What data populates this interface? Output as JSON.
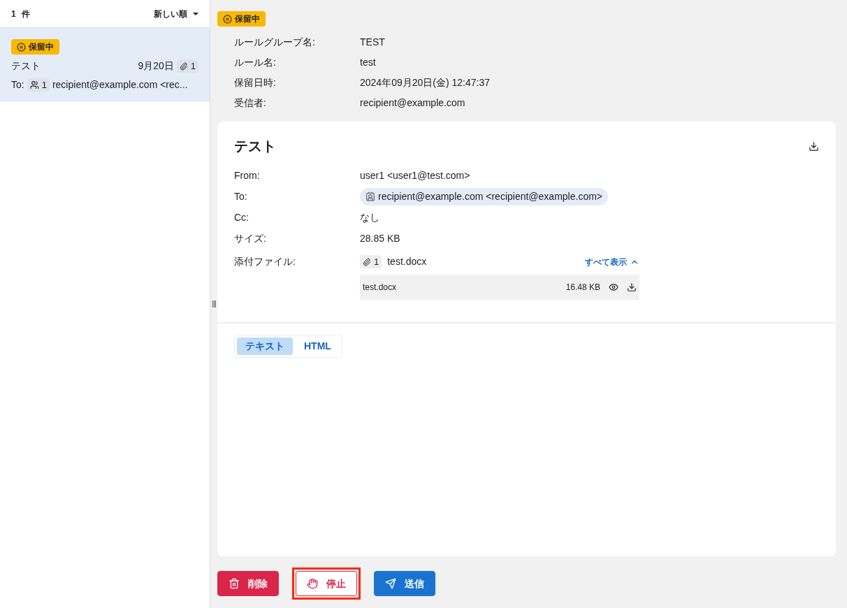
{
  "list_header": {
    "count": "1",
    "count_unit": "件",
    "sort": "新しい順"
  },
  "messages": [
    {
      "status": "保留中",
      "subject": "テスト",
      "date": "9月20日",
      "attachments": "1",
      "to_label": "To:",
      "recipients": "1",
      "to": "recipient@example.com <rec...",
      "selected": true
    }
  ],
  "hold_info": {
    "status": "保留中",
    "fields": [
      {
        "label": "ルールグループ名:",
        "value": "TEST"
      },
      {
        "label": "ルール名:",
        "value": "test"
      },
      {
        "label": "保留日時:",
        "value": "2024年09月20日(金) 12:47:37"
      },
      {
        "label": "受信者:",
        "value": "recipient@example.com"
      }
    ]
  },
  "mail": {
    "subject": "テスト",
    "fields": [
      {
        "kind": "text",
        "label": "From:",
        "value": "user1 <user1@test.com>"
      },
      {
        "kind": "chip",
        "label": "To:",
        "value": "recipient@example.com <recipient@example.com>"
      },
      {
        "kind": "text",
        "label": "Cc:",
        "value": "なし"
      },
      {
        "kind": "text",
        "label": "サイズ:",
        "value": "28.85 KB"
      }
    ],
    "attachments": {
      "label": "添付ファイル:",
      "count": "1",
      "first": "test.docx",
      "toggle": "すべて表示",
      "expanded": true,
      "files": [
        {
          "name": "test.docx",
          "size": "16.48 KB"
        }
      ]
    },
    "tabs": [
      {
        "label": "テキスト",
        "selected": true
      },
      {
        "label": "HTML",
        "selected": false
      }
    ]
  },
  "actions": [
    {
      "kind": "delete",
      "label": "削除",
      "highlighted": false
    },
    {
      "kind": "stop",
      "label": "停止",
      "highlighted": true
    },
    {
      "kind": "send",
      "label": "送信",
      "highlighted": false
    }
  ]
}
